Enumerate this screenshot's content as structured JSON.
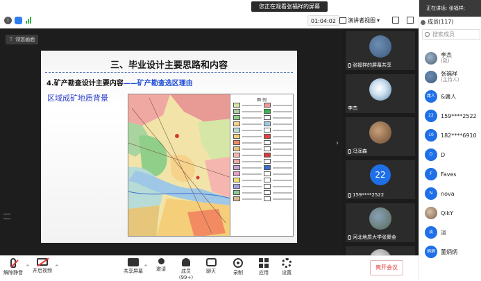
{
  "topbar": {
    "viewing_banner": "您正在观看张福祥的屏幕",
    "timer": "01:04:02",
    "view_mode": "演讲者视图"
  },
  "stage": {
    "return_button": "领您画面",
    "slide": {
      "title": "三、毕业设计主要思路和内容",
      "subtitle_black": "4.矿产勘查设计主要内容",
      "subtitle_blue": "——矿产勘查选区理由",
      "body_text": "区域成矿地质背景",
      "legend_title": "图 例"
    }
  },
  "tiles": [
    {
      "name": "张福祥的屏幕共享",
      "kind": "photo",
      "colors": [
        "#6d8db3",
        "#3c5c7e"
      ]
    },
    {
      "name": "李杰",
      "kind": "light"
    },
    {
      "name": "冯润森",
      "kind": "photo",
      "colors": [
        "#c9a078",
        "#6b4a33"
      ]
    },
    {
      "name": "159****2522",
      "kind": "text",
      "avatar_text": "22"
    },
    {
      "name": "河北地质大学张聚金",
      "kind": "photo",
      "colors": [
        "#8aa0b8",
        "#556b55"
      ]
    },
    {
      "name": "",
      "kind": "photo",
      "colors": [
        "#e6e6e6",
        "#777"
      ]
    }
  ],
  "panel": {
    "speaking": "正在讲话: 张福祥;",
    "members_label": "成员(117)",
    "search_placeholder": "搜索成员",
    "members": [
      {
        "name": "李杰",
        "role": "(我)",
        "avatar": "photo",
        "text": ""
      },
      {
        "name": "张福祥",
        "role": "(主持人)",
        "avatar": "photo",
        "text": ""
      },
      {
        "name": "&庸人",
        "role": "",
        "avatar": "text",
        "text": "庸人"
      },
      {
        "name": "159****2522",
        "role": "",
        "avatar": "text",
        "text": "22"
      },
      {
        "name": "182****6910",
        "role": "",
        "avatar": "text",
        "text": "10"
      },
      {
        "name": "D",
        "role": "",
        "avatar": "text",
        "text": "D"
      },
      {
        "name": "Faves",
        "role": "",
        "avatar": "text",
        "text": "F"
      },
      {
        "name": "nova",
        "role": "",
        "avatar": "text",
        "text": "N"
      },
      {
        "name": "QikY",
        "role": "",
        "avatar": "photo",
        "text": ""
      },
      {
        "name": "淡",
        "role": "",
        "avatar": "text",
        "text": "淡"
      },
      {
        "name": "董炳炳",
        "role": "",
        "avatar": "text",
        "text": "炳炳"
      }
    ]
  },
  "toolbar": {
    "unmute": "解除静音",
    "start_video": "开启视频",
    "share_screen": "共享屏幕",
    "invite": "邀请",
    "members": "成员(99+)",
    "chat": "聊天",
    "record": "录制",
    "apps": "应用",
    "settings": "设置",
    "leave": "离开会议"
  },
  "colors": {
    "accent_blue": "#1e6fe8",
    "danger_red": "#e53935",
    "slide_blue_text": "#2d3fc9"
  }
}
